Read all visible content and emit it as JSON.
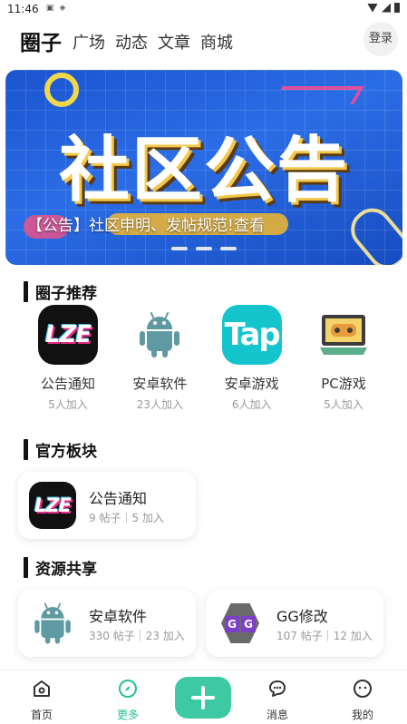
{
  "status_bar": {
    "time": "11:46"
  },
  "header": {
    "logo": "圈子",
    "tabs": [
      "广场",
      "动态",
      "文章",
      "商城"
    ],
    "login_label": "登录"
  },
  "banner": {
    "title": "社区公告",
    "caption": "【公告】社区申明、发帖规范!查看"
  },
  "sections": {
    "recommended": "圈子推荐",
    "official": "官方板块",
    "resources": "资源共享"
  },
  "recommended": [
    {
      "name": "公告通知",
      "count": "5人加入",
      "icon": "lze-icon"
    },
    {
      "name": "安卓软件",
      "count": "23人加入",
      "icon": "android-icon"
    },
    {
      "name": "安卓游戏",
      "count": "6人加入",
      "icon": "tap-icon"
    },
    {
      "name": "PC游戏",
      "count": "5人加入",
      "icon": "pc-game-icon"
    }
  ],
  "official": [
    {
      "title": "公告通知",
      "stats": "9 帖子｜5 加入",
      "icon": "lze-icon"
    }
  ],
  "resources": [
    {
      "title": "安卓软件",
      "stats": "330 帖子｜23 加入",
      "icon": "android-icon"
    },
    {
      "title": "GG修改",
      "stats": "107 帖子｜12 加入",
      "icon": "gg-icon"
    }
  ],
  "icon_text": {
    "lze": "LZE",
    "tap": "Tap",
    "g": "G"
  },
  "bottom_nav": {
    "home": "首页",
    "more": "更多",
    "messages": "消息",
    "mine": "我的"
  },
  "colors": {
    "accent": "#3cc9a4",
    "active_nav": "#26bf96",
    "banner_blue": "#2b6de6"
  }
}
